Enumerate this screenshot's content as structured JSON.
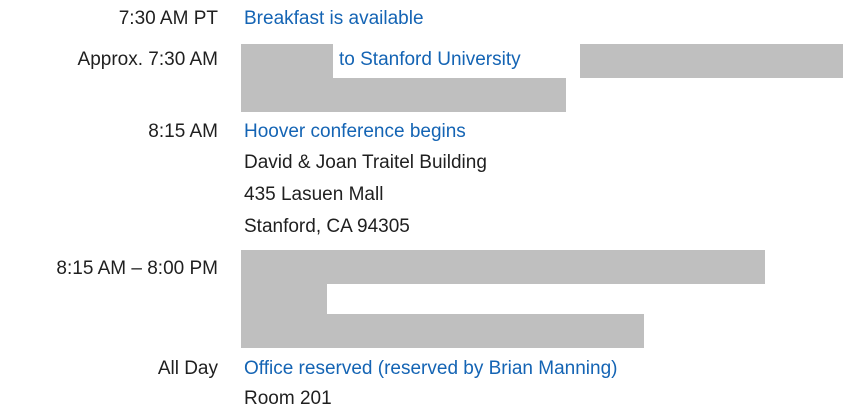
{
  "entries": [
    {
      "time": "7:30 AM PT",
      "title": "Breakfast is available",
      "details": []
    },
    {
      "time": "Approx. 7:30 AM",
      "title": "to Stanford University",
      "details": [],
      "redacted": true
    },
    {
      "time": "8:15 AM",
      "title": "Hoover conference begins",
      "details": [
        "David & Joan Traitel Building",
        "435 Lasuen Mall",
        "Stanford, CA 94305"
      ]
    },
    {
      "time": "8:15 AM – 8:00 PM",
      "title": "",
      "details": [],
      "redacted": true
    },
    {
      "time": "All Day",
      "title": "Office reserved (reserved by Brian Manning)",
      "details": [
        "Room 201"
      ]
    }
  ],
  "colors": {
    "link": "#1464b4",
    "text": "#1f1f1f",
    "redaction": "#bfbfbf"
  }
}
